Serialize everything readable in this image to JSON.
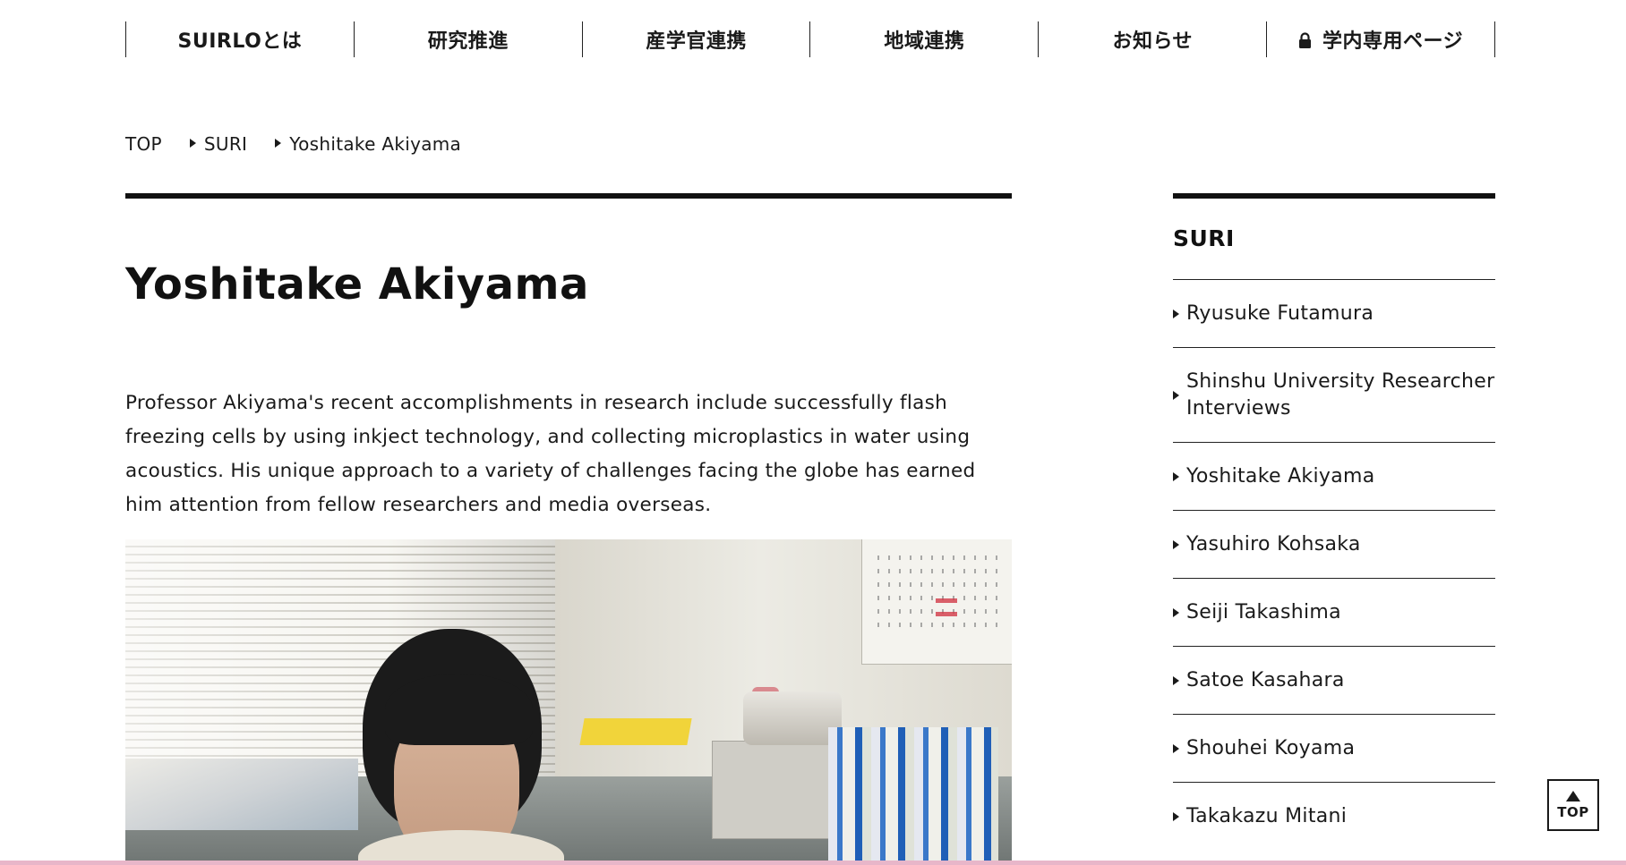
{
  "nav": {
    "items": [
      {
        "label": "SUIRLOとは"
      },
      {
        "label": "研究推進"
      },
      {
        "label": "産学官連携"
      },
      {
        "label": "地域連携"
      },
      {
        "label": "お知らせ"
      },
      {
        "label": "学内専用ページ",
        "icon": "lock-icon"
      }
    ]
  },
  "breadcrumb": {
    "items": [
      "TOP",
      "SURI",
      "Yoshitake Akiyama"
    ]
  },
  "main": {
    "title": "Yoshitake Akiyama",
    "intro": "Professor Akiyama's recent accomplishments in research include successfully flash freezing cells by using inkject technology, and collecting microplastics in water using acoustics. His unique approach to a variety of challenges facing the globe has earned him attention from fellow researchers and media overseas."
  },
  "sidebar": {
    "title": "SURI",
    "items": [
      {
        "label": "Ryusuke Futamura"
      },
      {
        "label": "Shinshu University Researcher Interviews"
      },
      {
        "label": "Yoshitake Akiyama"
      },
      {
        "label": "Yasuhiro Kohsaka"
      },
      {
        "label": "Seiji Takashima"
      },
      {
        "label": "Satoe Kasahara"
      },
      {
        "label": "Shouhei Koyama"
      },
      {
        "label": "Takakazu Mitani"
      }
    ]
  },
  "top_button": {
    "label": "TOP",
    "icon": "arrow-up-icon"
  },
  "colors": {
    "text": "#111111",
    "rule": "#111111",
    "bottom_strip": "#e8b6c9"
  }
}
